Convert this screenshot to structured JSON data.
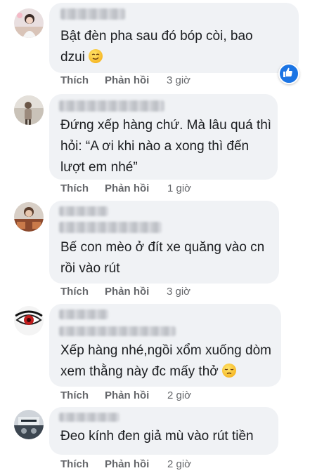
{
  "comments": [
    {
      "text": "Bật đèn pha sau đó bóp còi, bao\ndzui",
      "emoji": "smirk-emoji",
      "like_label": "Thích",
      "reply_label": "Phản hồi",
      "time": "3 giờ",
      "reactions": "like-icon"
    },
    {
      "text": "Đứng xếp hàng chứ. Mà lâu quá thì\nhỏi: “A ơi khi nào a xong thì đến\nlượt em nhé”",
      "like_label": "Thích",
      "reply_label": "Phản hồi",
      "time": "1 giờ"
    },
    {
      "text": "Bế con mèo ở đít xe quăng vào cn\nrồi vào rút",
      "like_label": "Thích",
      "reply_label": "Phản hồi",
      "time": "3 giờ"
    },
    {
      "text": "Xếp hàng nhé,ngồi xổm xuống dòm\nxem thằng này đc mấy thở",
      "emoji": "pensive-emoji",
      "like_label": "Thích",
      "reply_label": "Phản hồi",
      "time": "2 giờ"
    },
    {
      "text": "Đeo kính đen giả mù vào rút tiền",
      "like_label": "Thích",
      "reply_label": "Phản hồi",
      "time": "2 giờ"
    }
  ],
  "colors": {
    "bubble": "#f0f2f5",
    "text": "#1c1e21",
    "meta": "#65676b",
    "like_blue": "#1b74e4"
  }
}
